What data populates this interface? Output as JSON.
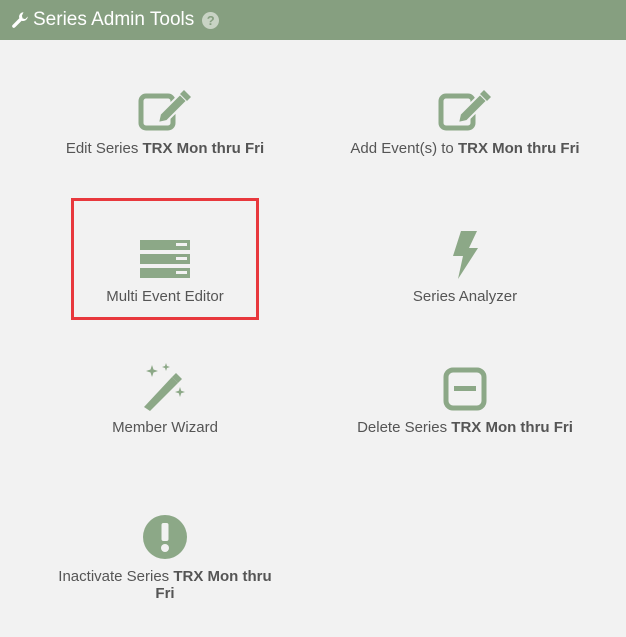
{
  "header": {
    "title": "Series Admin Tools",
    "help_glyph": "?",
    "icons": [
      "wrench-icon",
      "help-icon"
    ]
  },
  "colors": {
    "header_bg": "#869f80",
    "icon": "#8ca887",
    "highlight": "#e8383d",
    "background": "#f2f2f2"
  },
  "tiles": [
    {
      "icon": "edit-icon",
      "prefix": "Edit Series ",
      "bold": "TRX Mon thru Fri",
      "highlighted": false
    },
    {
      "icon": "edit-icon",
      "prefix": "Add Event(s) to ",
      "bold": "TRX Mon thru Fri",
      "highlighted": false
    },
    {
      "icon": "list-icon",
      "prefix": "Multi Event Editor",
      "bold": "",
      "highlighted": true
    },
    {
      "icon": "bolt-icon",
      "prefix": "Series Analyzer",
      "bold": "",
      "highlighted": false
    },
    {
      "icon": "magic-wand-icon",
      "prefix": "Member Wizard",
      "bold": "",
      "highlighted": false
    },
    {
      "icon": "minus-square-icon",
      "prefix": "Delete Series ",
      "bold": "TRX Mon thru Fri",
      "highlighted": false
    },
    {
      "icon": "exclamation-circle-icon",
      "prefix": "Inactivate Series ",
      "bold": "TRX Mon thru Fri",
      "highlighted": false
    }
  ]
}
